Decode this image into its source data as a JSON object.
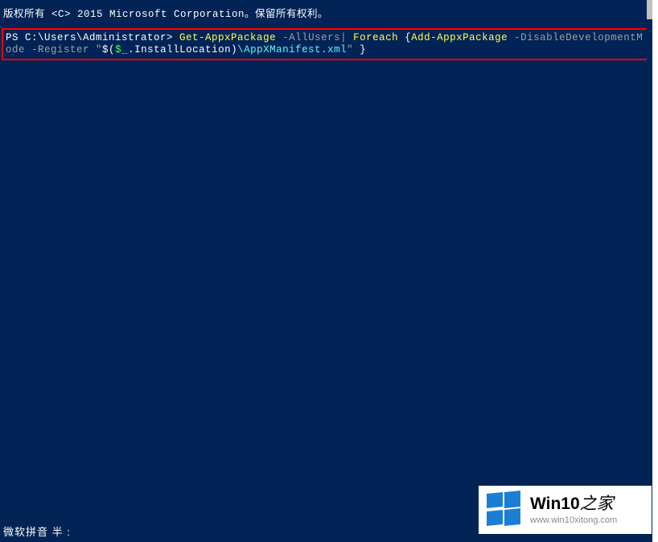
{
  "copyright": "版权所有 <C> 2015 Microsoft Corporation。保留所有权利。",
  "command": {
    "prompt": "PS C:\\Users\\Administrator> ",
    "cmd1": "Get-AppxPackage",
    "param1": " -AllUsers",
    "bar": "|",
    "keyword": " Foreach ",
    "brace_open": "{",
    "cmd2": "Add-AppxPackage",
    "param2": " -DisableDevelopmentMode -Register ",
    "quote_open": "\"",
    "expr_open": "$(",
    "dollar": "$_",
    "prop": ".InstallLocation",
    "expr_close": ")",
    "path": "\\AppXManifest.xml",
    "quote_close": "\"",
    "end": " }"
  },
  "ime": "微软拼音 半 :",
  "watermark": {
    "title_main": "Win10",
    "title_suffix": "之家",
    "url": "www.win10xitong.com"
  }
}
